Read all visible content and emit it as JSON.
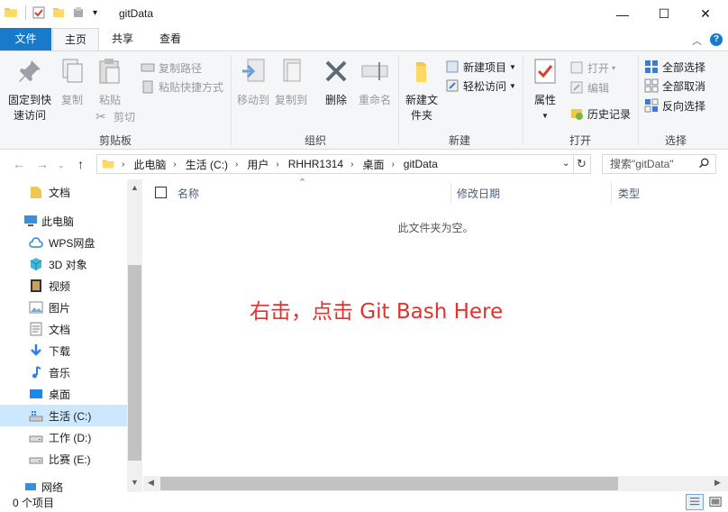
{
  "window": {
    "title": "gitData",
    "minimize": "—",
    "maximize": "☐",
    "close": "✕"
  },
  "ribbon_tabs": {
    "file": "文件",
    "home": "主页",
    "share": "共享",
    "view": "查看"
  },
  "ribbon": {
    "clipboard": {
      "label": "剪贴板",
      "pin": "固定到快速访问",
      "copy": "复制",
      "paste": "粘贴",
      "copy_path": "复制路径",
      "paste_shortcut": "粘贴快捷方式",
      "cut": "剪切"
    },
    "organize": {
      "label": "组织",
      "move_to": "移动到",
      "copy_to": "复制到",
      "delete": "删除",
      "rename": "重命名"
    },
    "new": {
      "label": "新建",
      "new_folder": "新建文件夹",
      "new_item": "新建项目",
      "easy_access": "轻松访问"
    },
    "open": {
      "label": "打开",
      "properties": "属性",
      "open": "打开",
      "edit": "编辑",
      "history": "历史记录"
    },
    "select": {
      "label": "选择",
      "select_all": "全部选择",
      "select_none": "全部取消",
      "invert": "反向选择"
    }
  },
  "address": {
    "crumbs": [
      "此电脑",
      "生活 (C:)",
      "用户",
      "RHHR1314",
      "桌面",
      "gitData"
    ],
    "search_placeholder": "搜索\"gitData\""
  },
  "sidebar": {
    "items": [
      {
        "label": "文档",
        "icon": "folder-icon"
      },
      {
        "label": "此电脑",
        "icon": "computer-icon"
      },
      {
        "label": "WPS网盘",
        "icon": "cloud-icon"
      },
      {
        "label": "3D 对象",
        "icon": "cube-icon"
      },
      {
        "label": "视频",
        "icon": "video-icon"
      },
      {
        "label": "图片",
        "icon": "picture-icon"
      },
      {
        "label": "文档",
        "icon": "document-icon"
      },
      {
        "label": "下载",
        "icon": "download-icon"
      },
      {
        "label": "音乐",
        "icon": "music-icon"
      },
      {
        "label": "桌面",
        "icon": "desktop-icon"
      },
      {
        "label": "生活 (C:)",
        "icon": "drive-c-icon"
      },
      {
        "label": "工作 (D:)",
        "icon": "drive-icon"
      },
      {
        "label": "比赛 (E:)",
        "icon": "drive-icon"
      },
      {
        "label": "网络",
        "icon": "network-icon"
      }
    ]
  },
  "content": {
    "columns": {
      "name": "名称",
      "modified": "修改日期",
      "type": "类型"
    },
    "empty_message": "此文件夹为空。",
    "annotation": "右击，点击 Git Bash Here"
  },
  "status": {
    "item_count": "0 个项目"
  },
  "colors": {
    "accent": "#1979ca",
    "annotation": "#e5312c",
    "selected": "#cce8ff"
  }
}
